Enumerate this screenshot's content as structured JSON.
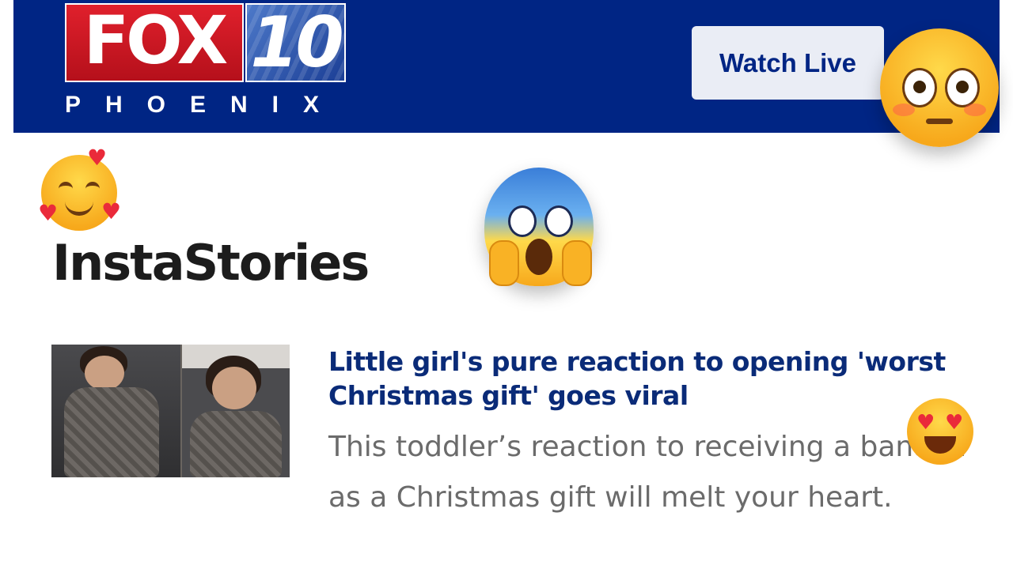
{
  "header": {
    "logo_station": "FOX",
    "logo_number": "10",
    "logo_city": "PHOENIX",
    "watch_live_label": "Watch Live",
    "background_color": "#002584"
  },
  "section": {
    "title": "InstaStories"
  },
  "article": {
    "title": "Little girl's pure reaction to opening 'worst Christmas gift' goes viral",
    "summary": "This toddler’s reaction to receiving a banana as a Christmas gift will melt your heart.",
    "title_color": "#0a2b78",
    "summary_color": "#6b6b6b"
  },
  "overlays": {
    "emojis": [
      "flushed-face-icon",
      "smiling-face-with-hearts-icon",
      "face-screaming-in-fear-icon",
      "heart-eyes-face-icon"
    ]
  }
}
